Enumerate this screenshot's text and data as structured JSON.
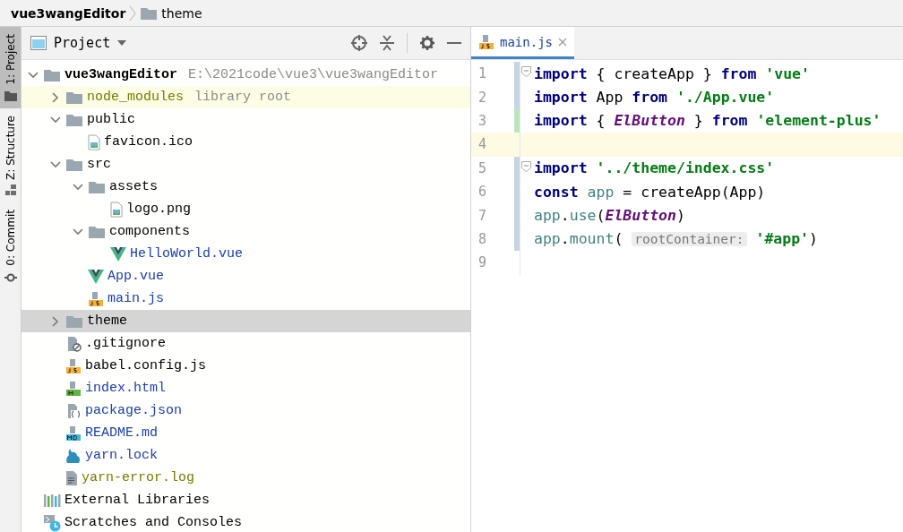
{
  "breadcrumb": [
    {
      "label": "vue3wangEditor",
      "kind": "project"
    },
    {
      "label": "theme",
      "kind": "folder"
    }
  ],
  "tool_strip": [
    {
      "label": "1: Project",
      "kind": "folder",
      "selected": true
    },
    {
      "label": "Z: Structure",
      "kind": "structure",
      "selected": false
    },
    {
      "label": "0: Commit",
      "kind": "commit",
      "selected": false
    }
  ],
  "project_panel": {
    "title": "Project",
    "tree": [
      {
        "name": "vue3wangEditor",
        "kind": "folder",
        "path": "E:\\2021code\\vue3\\vue3wangEditor",
        "color": "#000000",
        "expanded": true,
        "selected": false,
        "library": false,
        "children": [
          {
            "name": "node_modules",
            "kind": "folder",
            "note": "library root",
            "color": "#7a7a00",
            "expanded": false,
            "selected": false,
            "library": true
          },
          {
            "name": "public",
            "kind": "folder",
            "color": "#000000",
            "expanded": true,
            "selected": false,
            "library": false,
            "children": [
              {
                "name": "favicon.ico",
                "kind": "image",
                "color": "#000000",
                "selected": false,
                "library": false
              }
            ]
          },
          {
            "name": "src",
            "kind": "folder",
            "color": "#000000",
            "expanded": true,
            "selected": false,
            "library": false,
            "children": [
              {
                "name": "assets",
                "kind": "folder",
                "color": "#000000",
                "expanded": true,
                "selected": false,
                "library": false,
                "children": [
                  {
                    "name": "logo.png",
                    "kind": "image",
                    "color": "#000000",
                    "selected": false,
                    "library": false
                  }
                ]
              },
              {
                "name": "components",
                "kind": "folder",
                "color": "#000000",
                "expanded": true,
                "selected": false,
                "library": false,
                "children": [
                  {
                    "name": "HelloWorld.vue",
                    "kind": "vue",
                    "color": "#1a3fb0",
                    "selected": false,
                    "library": false
                  }
                ]
              },
              {
                "name": "App.vue",
                "kind": "vue",
                "color": "#1a3fb0",
                "selected": false,
                "library": false
              },
              {
                "name": "main.js",
                "kind": "js",
                "color": "#1a3fb0",
                "selected": false,
                "library": false
              }
            ]
          },
          {
            "name": "theme",
            "kind": "folder",
            "color": "#000000",
            "expanded": false,
            "selected": true,
            "library": false
          },
          {
            "name": ".gitignore",
            "kind": "ignore",
            "color": "#000000",
            "selected": false,
            "library": false
          },
          {
            "name": "babel.config.js",
            "kind": "js",
            "color": "#000000",
            "selected": false,
            "library": false
          },
          {
            "name": "index.html",
            "kind": "html",
            "color": "#1a3fb0",
            "selected": false,
            "library": false
          },
          {
            "name": "package.json",
            "kind": "json",
            "color": "#1a3fb0",
            "selected": false,
            "library": false
          },
          {
            "name": "README.md",
            "kind": "md",
            "color": "#1a3fb0",
            "selected": false,
            "library": false
          },
          {
            "name": "yarn.lock",
            "kind": "yarn",
            "color": "#1a3fb0",
            "selected": false,
            "library": false
          },
          {
            "name": "yarn-error.log",
            "kind": "log",
            "color": "#7a7a00",
            "selected": false,
            "library": false
          }
        ]
      },
      {
        "name": "External Libraries",
        "kind": "libraries",
        "color": "#000000",
        "selected": false,
        "library": false
      },
      {
        "name": "Scratches and Consoles",
        "kind": "scratch",
        "color": "#000000",
        "selected": false,
        "library": false
      }
    ]
  },
  "editor": {
    "tabs": [
      {
        "label": "main.js",
        "kind": "js",
        "selected": true
      }
    ],
    "lines": [
      {
        "number": "1",
        "color": "#c6d4e6",
        "fold": true,
        "current": false,
        "tokens": [
          {
            "text": "import ",
            "kind": "kw"
          },
          {
            "text": "{ createApp } ",
            "kind": "plain"
          },
          {
            "text": "from ",
            "kind": "kw"
          },
          {
            "text": "'vue'",
            "kind": "str"
          }
        ]
      },
      {
        "number": "2",
        "color": "#c6d4e6",
        "fold": false,
        "current": false,
        "tokens": [
          {
            "text": "import ",
            "kind": "kw"
          },
          {
            "text": "App ",
            "kind": "plain"
          },
          {
            "text": "from ",
            "kind": "kw"
          },
          {
            "text": "'./App.vue'",
            "kind": "str"
          }
        ]
      },
      {
        "number": "3",
        "color": "#bee6be",
        "fold": false,
        "current": false,
        "tokens": [
          {
            "text": "import ",
            "kind": "kw"
          },
          {
            "text": "{ ",
            "kind": "plain"
          },
          {
            "text": "ElButton",
            "kind": "ital"
          },
          {
            "text": " } ",
            "kind": "plain"
          },
          {
            "text": "from ",
            "kind": "kw"
          },
          {
            "text": "'element-plus'",
            "kind": "str"
          }
        ]
      },
      {
        "number": "4",
        "fold": false,
        "current": true
      },
      {
        "number": "5",
        "color": "#c6d4e6",
        "fold": true,
        "current": false,
        "tokens": [
          {
            "text": "import ",
            "kind": "kw"
          },
          {
            "text": "'../theme/index.css'",
            "kind": "str"
          }
        ]
      },
      {
        "number": "6",
        "color": "#c6d4e6",
        "fold": false,
        "current": false,
        "tokens": [
          {
            "text": "const ",
            "kind": "kw"
          },
          {
            "text": "app",
            "kind": "var"
          },
          {
            "text": " = createApp(App)",
            "kind": "plain"
          }
        ]
      },
      {
        "number": "7",
        "color": "#c6d4e6",
        "fold": false,
        "current": false,
        "tokens": [
          {
            "text": "app",
            "kind": "var"
          },
          {
            "text": ".",
            "kind": "plain"
          },
          {
            "text": "use",
            "kind": "var"
          },
          {
            "text": "(",
            "kind": "plain"
          },
          {
            "text": "ElButton",
            "kind": "ital"
          },
          {
            "text": ")",
            "kind": "plain"
          }
        ]
      },
      {
        "number": "8",
        "color": "#c6d4e6",
        "fold": false,
        "current": false,
        "tokens": [
          {
            "text": "app",
            "kind": "var"
          },
          {
            "text": ".",
            "kind": "plain"
          },
          {
            "text": "mount",
            "kind": "var"
          },
          {
            "text": "( ",
            "kind": "plain"
          },
          {
            "text": "rootContainer:",
            "kind": "hint"
          },
          {
            "text": " '#app'",
            "kind": "str"
          },
          {
            "text": ")",
            "kind": "plain"
          }
        ]
      },
      {
        "number": "9",
        "fold": false,
        "current": false
      }
    ]
  }
}
